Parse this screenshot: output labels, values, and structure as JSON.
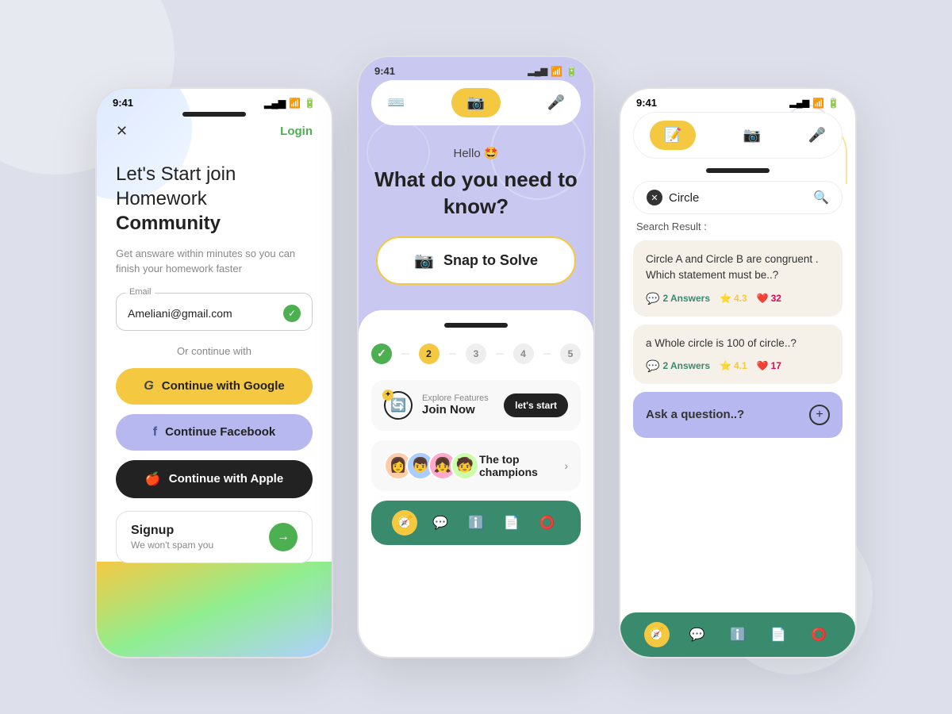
{
  "background": {
    "color": "#dde0ea"
  },
  "phone1": {
    "status_time": "9:41",
    "close_label": "✕",
    "login_label": "Login",
    "headline_part1": "Let's Start join",
    "headline_part2": "Homework ",
    "headline_bold": "Community",
    "subtext": "Get answare within minutes so you can finish your homework faster",
    "email_label": "Email",
    "email_value": "Ameliani@gmail.com",
    "or_text": "Or continue with",
    "google_btn": "Continue with Google",
    "facebook_btn": "Continue Facebook",
    "apple_btn": "Continue with Apple",
    "signup_title": "Signup",
    "signup_sub": "We won't spam you"
  },
  "phone2": {
    "status_time": "9:41",
    "greeting": "Hello 🤩",
    "main_question": "What do you need to know?",
    "snap_label": "Snap to Solve",
    "steps": [
      "✓",
      "2",
      "3",
      "4",
      "5"
    ],
    "explore_sub": "Explore Features",
    "explore_title": "Join Now",
    "lets_start": "let's start",
    "champions_label": "The top champions",
    "nav_icons": [
      "compass",
      "chat",
      "info",
      "bookmark",
      "circle"
    ]
  },
  "phone3": {
    "status_time": "9:41",
    "search_value": "Circle",
    "search_result_label": "Search Result :",
    "results": [
      {
        "question": "Circle A and Circle B are congruent . Which statement must be..?",
        "answers": "2 Answers",
        "rating": "4.3",
        "likes": "32"
      },
      {
        "question": "a Whole circle is 100 of circle..?",
        "answers": "2 Answers",
        "rating": "4.1",
        "likes": "17"
      }
    ],
    "ask_label": "Ask a question..?",
    "nav_icons": [
      "compass",
      "chat",
      "info",
      "bookmark",
      "circle"
    ]
  }
}
